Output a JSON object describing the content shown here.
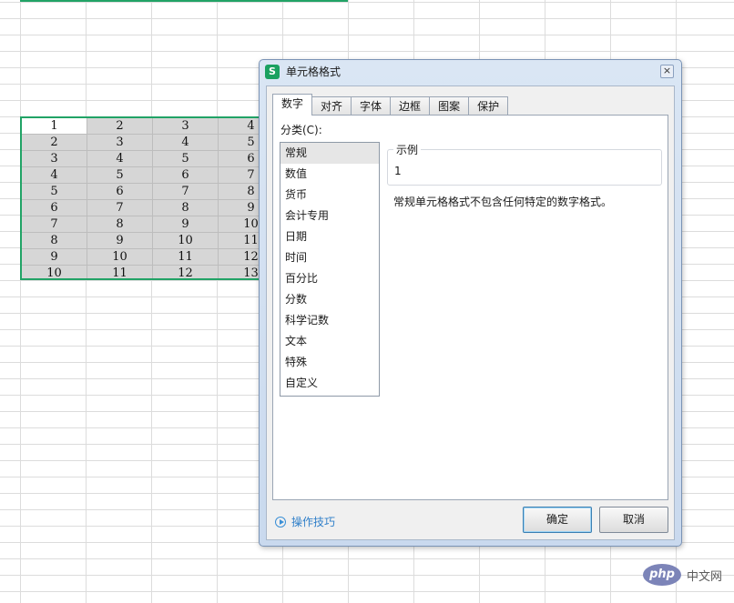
{
  "sheet": {
    "rows": [
      [
        "1",
        "2",
        "3",
        "4"
      ],
      [
        "2",
        "3",
        "4",
        "5"
      ],
      [
        "3",
        "4",
        "5",
        "6"
      ],
      [
        "4",
        "5",
        "6",
        "7"
      ],
      [
        "5",
        "6",
        "7",
        "8"
      ],
      [
        "6",
        "7",
        "8",
        "9"
      ],
      [
        "7",
        "8",
        "9",
        "10"
      ],
      [
        "8",
        "9",
        "10",
        "11"
      ],
      [
        "9",
        "10",
        "11",
        "12"
      ],
      [
        "10",
        "11",
        "12",
        "13"
      ]
    ]
  },
  "dialog": {
    "icon_text": "S",
    "title": "单元格格式",
    "tabs": [
      {
        "label": "数字"
      },
      {
        "label": "对齐"
      },
      {
        "label": "字体"
      },
      {
        "label": "边框"
      },
      {
        "label": "图案"
      },
      {
        "label": "保护"
      }
    ],
    "category_label": "分类(C):",
    "categories": [
      {
        "label": "常规"
      },
      {
        "label": "数值"
      },
      {
        "label": "货币"
      },
      {
        "label": "会计专用"
      },
      {
        "label": "日期"
      },
      {
        "label": "时间"
      },
      {
        "label": "百分比"
      },
      {
        "label": "分数"
      },
      {
        "label": "科学记数"
      },
      {
        "label": "文本"
      },
      {
        "label": "特殊"
      },
      {
        "label": "自定义"
      }
    ],
    "sample_label": "示例",
    "sample_value": "1",
    "description": "常规单元格格式不包含任何特定的数字格式。",
    "tips_label": "操作技巧",
    "ok_label": "确定",
    "cancel_label": "取消",
    "close_symbol": "×"
  },
  "watermark": {
    "logo_text": "php",
    "site_text": "中文网"
  },
  "colors": {
    "selection_border": "#21a366",
    "dialog_frame": "#c9d9ee",
    "link": "#2f7fc9"
  }
}
